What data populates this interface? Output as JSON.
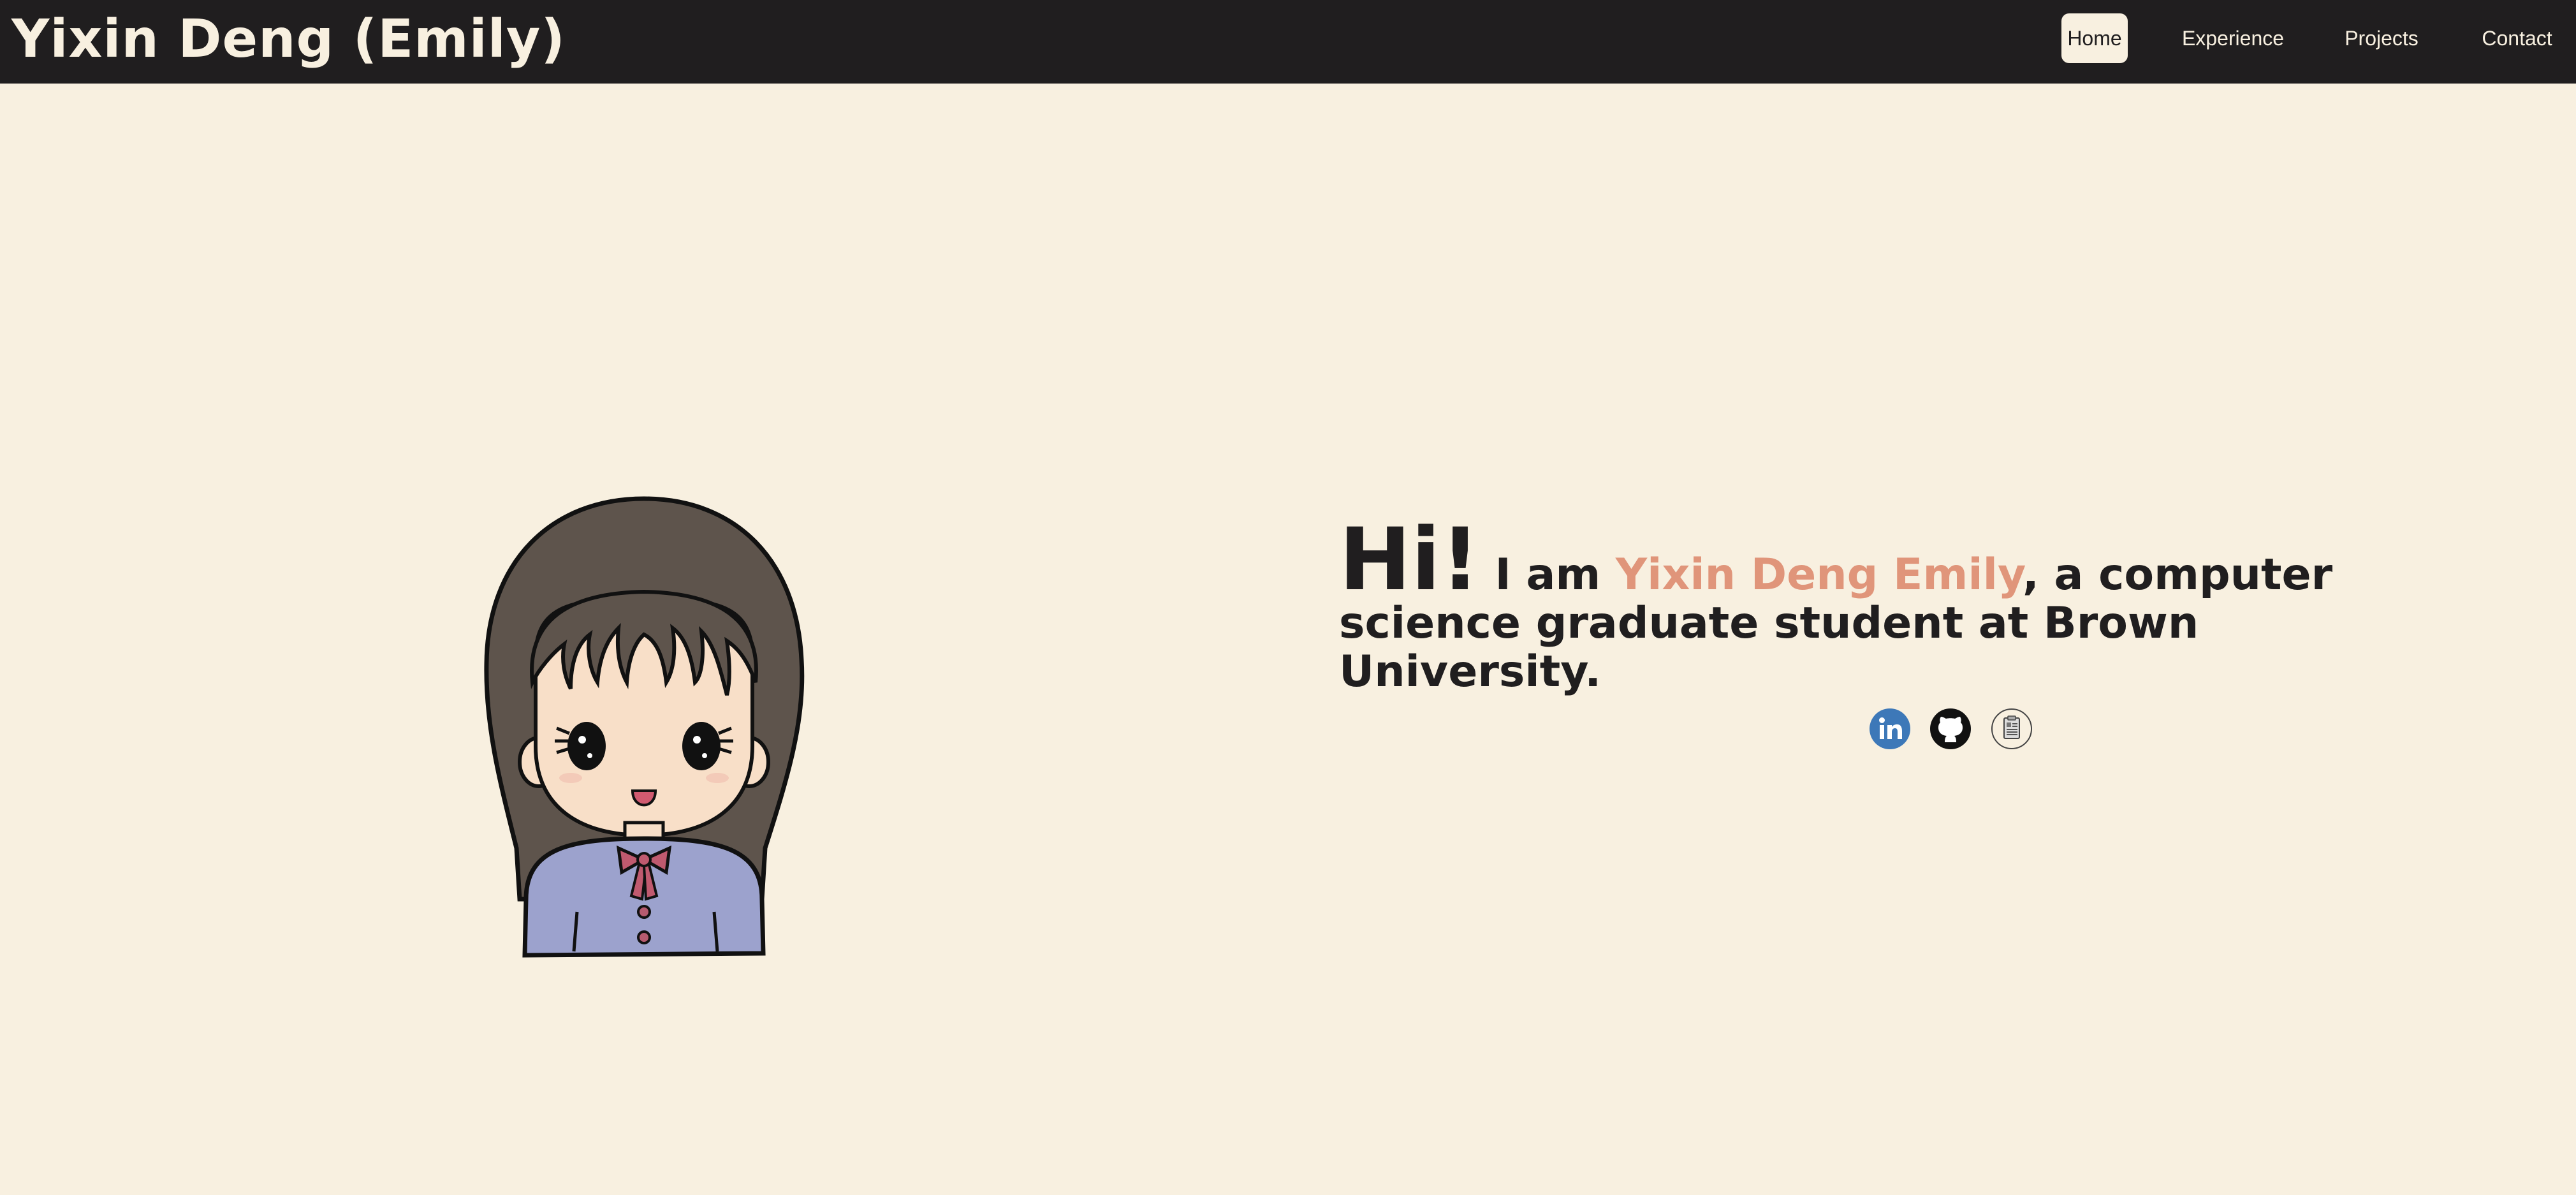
{
  "header": {
    "site_title": "Yixin Deng (Emily)"
  },
  "nav": {
    "items": [
      {
        "label": "Home",
        "active": true
      },
      {
        "label": "Experience",
        "active": false
      },
      {
        "label": "Projects",
        "active": false
      },
      {
        "label": "Contact",
        "active": false
      }
    ]
  },
  "hero": {
    "greeting": "Hi!",
    "intro_prefix": " I am ",
    "name": "Yixin Deng Emily",
    "intro_suffix": ", a computer science graduate student at Brown University."
  },
  "social_links": [
    {
      "icon": "linkedin-icon"
    },
    {
      "icon": "github-icon"
    },
    {
      "icon": "resume-icon"
    }
  ],
  "colors": {
    "background": "#f8f0e0",
    "navbar": "#201e1f",
    "accent": "#e0957a",
    "linkedin": "#3d78b8"
  }
}
